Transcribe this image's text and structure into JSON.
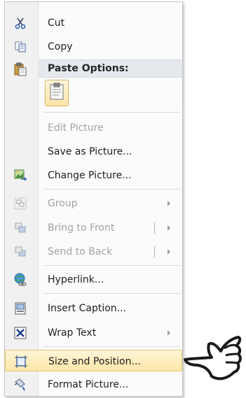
{
  "menu": {
    "cut": {
      "label": "Cut",
      "icon": "scissors-icon"
    },
    "copy": {
      "label": "Copy",
      "icon": "copy-icon"
    },
    "paste_header": {
      "label": "Paste Options:",
      "icon": "paste-icon"
    },
    "paste_option": {
      "icon": "clipboard-icon"
    },
    "edit_picture": {
      "label": "Edit Picture",
      "disabled": true
    },
    "save_as_picture": {
      "label": "Save as Picture..."
    },
    "change_picture": {
      "label": "Change Picture...",
      "icon": "change-picture-icon"
    },
    "group": {
      "label": "Group",
      "disabled": true,
      "submenu": true,
      "icon": "group-icon"
    },
    "bring_to_front": {
      "label": "Bring to Front",
      "disabled": true,
      "split_submenu": true,
      "icon": "bring-to-front-icon"
    },
    "send_to_back": {
      "label": "Send to Back",
      "disabled": true,
      "split_submenu": true,
      "icon": "send-to-back-icon"
    },
    "hyperlink": {
      "label": "Hyperlink...",
      "icon": "hyperlink-icon"
    },
    "insert_caption": {
      "label": "Insert Caption...",
      "icon": "caption-icon"
    },
    "wrap_text": {
      "label": "Wrap Text",
      "submenu": true,
      "icon": "wrap-text-icon"
    },
    "size_and_position": {
      "label": "Size and Position...",
      "highlighted": true,
      "icon": "size-position-icon"
    },
    "format_picture": {
      "label": "Format Picture...",
      "icon": "format-picture-icon"
    }
  },
  "pointer": {
    "icon": "pointing-hand-icon"
  },
  "colors": {
    "highlight": "#fde6a8",
    "disabled_text": "#a3a3a3",
    "header_bg": "#e5e9ee"
  }
}
